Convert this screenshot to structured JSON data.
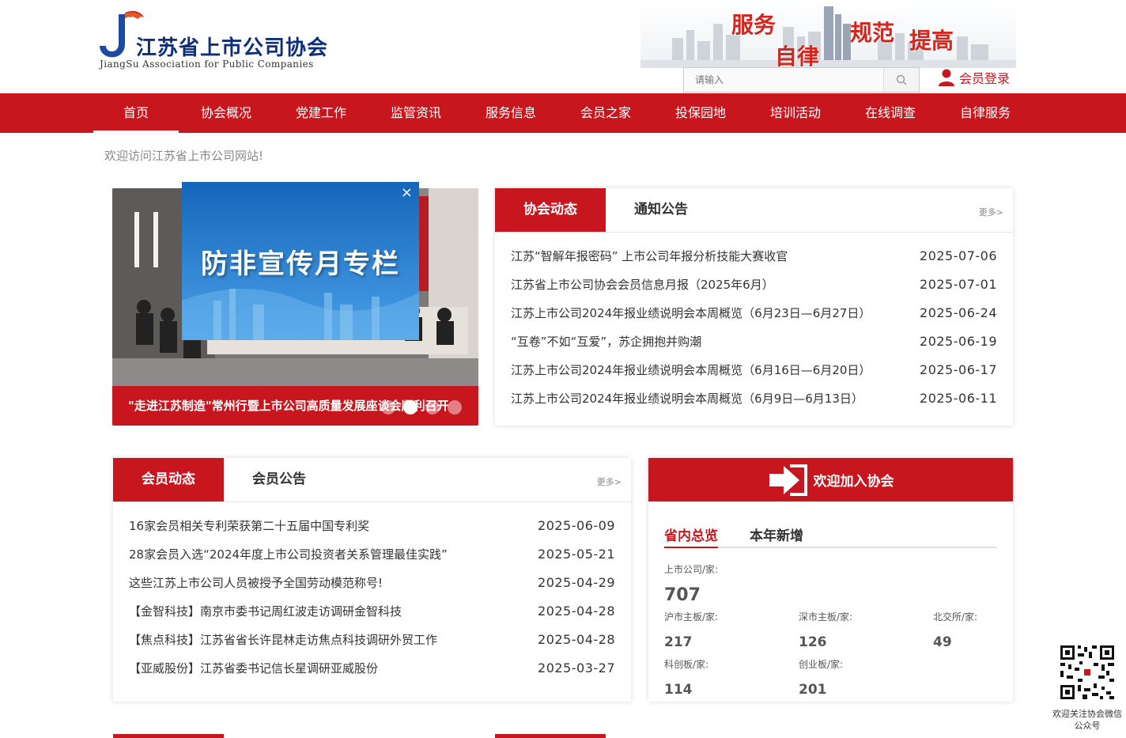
{
  "logo": {
    "cn": "江苏省上市公司协会",
    "en": "JiangSu Association for Public Companies"
  },
  "banner": {
    "slogans": [
      "服务",
      "自律",
      "规范",
      "提高"
    ]
  },
  "search": {
    "placeholder": "请输入"
  },
  "login": {
    "label": "会员登录"
  },
  "nav": {
    "items": [
      "首页",
      "协会概况",
      "党建工作",
      "监管资讯",
      "服务信息",
      "会员之家",
      "投保园地",
      "培训活动",
      "在线调查",
      "自律服务"
    ]
  },
  "welcome": "欢迎访问江苏省上市公司网站!",
  "slider": {
    "caption": "\"走进江苏制造\"常州行暨上市公司高质量发展座谈会顺利召开",
    "dot_count": 4,
    "active_dot": 1
  },
  "popup": {
    "title": "防非宣传月专栏",
    "close": "×"
  },
  "news": {
    "tabs": [
      "协会动态",
      "通知公告"
    ],
    "more": "更多>",
    "items": [
      {
        "title": "江苏“智解年报密码” 上市公司年报分析技能大赛收官",
        "date": "2025-07-06"
      },
      {
        "title": "江苏省上市公司协会会员信息月报（2025年6月）",
        "date": "2025-07-01"
      },
      {
        "title": "江苏上市公司2024年报业绩说明会本周概览（6月23日—6月27日）",
        "date": "2025-06-24"
      },
      {
        "title": "“互卷”不如“互爱”，苏企拥抱并购潮",
        "date": "2025-06-19"
      },
      {
        "title": "江苏上市公司2024年报业绩说明会本周概览（6月16日—6月20日）",
        "date": "2025-06-17"
      },
      {
        "title": "江苏上市公司2024年报业绩说明会本周概览（6月9日—6月13日）",
        "date": "2025-06-11"
      }
    ]
  },
  "members": {
    "tabs": [
      "会员动态",
      "会员公告"
    ],
    "more": "更多>",
    "items": [
      {
        "title": "16家会员相关专利荣获第二十五届中国专利奖",
        "date": "2025-06-09"
      },
      {
        "title": "28家会员入选“2024年度上市公司投资者关系管理最佳实践”",
        "date": "2025-05-21"
      },
      {
        "title": "这些江苏上市公司人员被授予全国劳动模范称号!",
        "date": "2025-04-29"
      },
      {
        "title": "【金智科技】南京市委书记周红波走访调研金智科技",
        "date": "2025-04-28"
      },
      {
        "title": "【焦点科技】江苏省省长许昆林走访焦点科技调研外贸工作",
        "date": "2025-04-28"
      },
      {
        "title": "【亚威股份】江苏省委书记信长星调研亚威股份",
        "date": "2025-03-27"
      }
    ]
  },
  "join": {
    "title": "欢迎加入协会",
    "tabs": [
      "省内总览",
      "本年新增"
    ],
    "total_label": "上市公司/家:",
    "total": "707",
    "stats": [
      {
        "label": "沪市主板/家:",
        "value": "217"
      },
      {
        "label": "深市主板/家:",
        "value": "126"
      },
      {
        "label": "北交所/家:",
        "value": "49"
      },
      {
        "label": "科创板/家:",
        "value": "114"
      },
      {
        "label": "创业板/家:",
        "value": "201"
      }
    ]
  },
  "qr": {
    "text": "欢迎关注协会微信公众号"
  },
  "colors": {
    "brand_red": "#c8161e",
    "logo_blue": "#0d2f7a"
  }
}
